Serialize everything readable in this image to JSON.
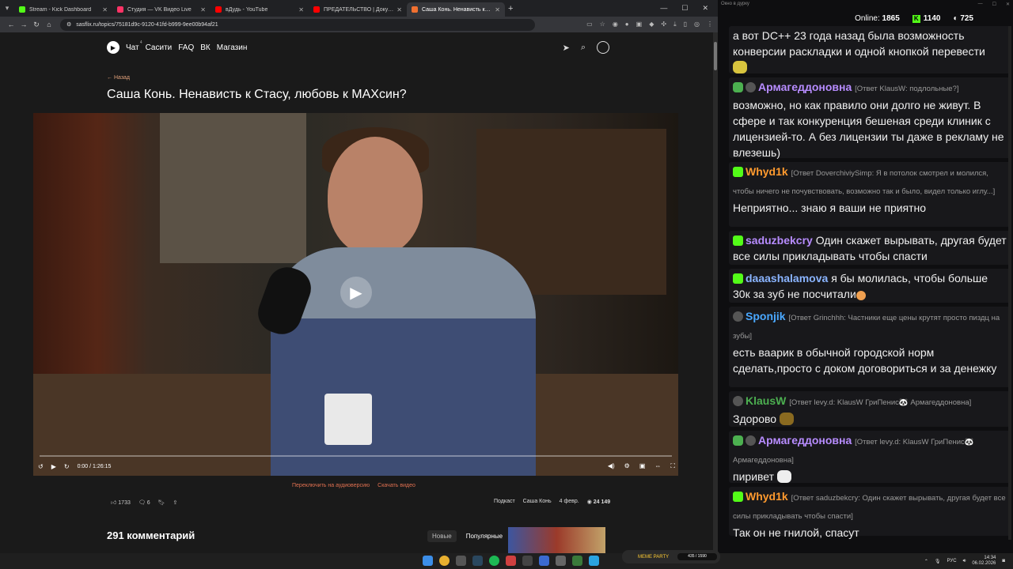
{
  "browser": {
    "tabs": [
      {
        "label": "Stream - Kick Dashboard",
        "color": "#53fc18",
        "active": false
      },
      {
        "label": "Студия — VK Видео Live",
        "color": "#ff3366",
        "active": false
      },
      {
        "label": "вДудь - YouTube",
        "color": "#ff0000",
        "active": false
      },
      {
        "label": "ПРЕДАТЕЛЬСТВО | Документаль",
        "color": "#ff0000",
        "active": false
      },
      {
        "label": "Саша Конь. Ненависть к Стасу",
        "color": "#f07030",
        "active": true
      }
    ],
    "url": "sasflix.ru/topics/75181d9c-9120-41fd-b999-9ee00b94af21"
  },
  "site": {
    "nav": {
      "chat": "Чат",
      "chat_count": "4",
      "sasiti": "Сасити",
      "faq": "FAQ",
      "vk": "ВК",
      "shop": "Магазин"
    },
    "back": "← Назад",
    "title": "Саша Конь. Ненависть к Стасу, любовь к MAXсин?",
    "video": {
      "time": "0:00 / 1:26:15",
      "progress": 0
    },
    "links": {
      "audio": "Переключить на аудиоверсию",
      "download": "Скачать видео"
    },
    "likes": "1733",
    "comments_icon_count": "6",
    "tags": {
      "podcast": "Подкаст",
      "person": "Саша Конь"
    },
    "date": "4 февр.",
    "views": "24 149",
    "comment_count": "291 комментарий",
    "sort": {
      "new": "Новые",
      "popular": "Популярные"
    }
  },
  "chat": {
    "window_title": "Окно в дурку",
    "online_label": "Online:",
    "online": "1865",
    "kick_count": "1140",
    "vk_count": "725",
    "messages": [
      {
        "text": "а вот DC++ 23 года назад была возможность конверсии раскладки и одной кнопкой перевести"
      },
      {
        "user": "Армагеддоновна",
        "color": "#b78cff",
        "reply": "[Ответ KlausW: подлольные?]",
        "text": "возможно, но как правило они долго не живут. В сфере и так конкуренция бешеная среди клиник с лицензией-то. А без лицензии ты даже в рекламу не влезешь)"
      },
      {
        "user": "Whyd1k",
        "color": "#ff9a2e",
        "reply": "[Ответ DoverchiviySimp: Я в потолок смотрел и молился, чтобы ничего не почувствовать, возможно так и было, видел только иглу...]",
        "text": "Неприятно... знаю я ваши не приятно"
      },
      {
        "user": "saduzbekcry",
        "color": "#b78cff",
        "text": "Один скажет вырывать, другая будет все силы прикладывать чтобы спасти"
      },
      {
        "user": "daaashalamova",
        "color": "#8ab4ff",
        "text": "я бы молилась, чтобы больше 30к за зуб не посчитали"
      },
      {
        "user": "Sponjik",
        "color": "#4aa8ff",
        "reply": "[Ответ Grinchhh: Частники еще цены крутят просто пиздц на зубы]",
        "text": "есть ваарик в обычной городской норм сделать,просто с доком договориться и за денежку"
      },
      {
        "user": "KlausW",
        "color": "#4caf50",
        "reply": "[Ответ levy.d: KlausW ГриПенис🐼 Армагеддоновна]",
        "text": "Здорово"
      },
      {
        "user": "Армагеддоновна",
        "color": "#b78cff",
        "reply": "[Ответ levy.d: KlausW ГриПенис🐼 Армагеддоновна]",
        "text": "пиривет"
      },
      {
        "user": "Whyd1k",
        "color": "#ff9a2e",
        "reply": "[Ответ saduzbekcry: Один скажет вырывать, другая будет все силы прикладывать чтобы спасти]",
        "text": "Так он не гнилой, спасут"
      }
    ]
  },
  "taskbar": {
    "meme_label": "MEME PARTY",
    "meme_progress": "435 / 1590",
    "lang": "РУС",
    "time": "14:34",
    "date": "06.02.2026"
  }
}
